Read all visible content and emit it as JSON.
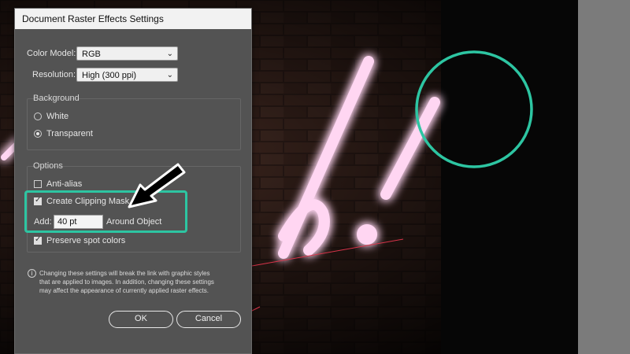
{
  "dialog": {
    "title": "Document Raster Effects Settings",
    "color_model_label": "Color Model:",
    "color_model_value": "RGB",
    "resolution_label": "Resolution:",
    "resolution_value": "High (300 ppi)",
    "background_group": "Background",
    "white_label": "White",
    "transparent_label": "Transparent",
    "options_group": "Options",
    "anti_alias_label": "Anti-alias",
    "clipping_mask_label": "Create Clipping Mask",
    "add_label": "Add:",
    "add_value": "40 pt",
    "around_object_label": "Around Object",
    "preserve_spot_label": "Preserve spot colors",
    "note_line1": "Changing these settings will break the link with graphic styles",
    "note_line2": "that are applied to images. In addition, changing these settings",
    "note_line3": "may affect the appearance of currently applied raster effects.",
    "ok_label": "OK",
    "cancel_label": "Cancel"
  },
  "state": {
    "background_selected": "Transparent",
    "anti_alias": false,
    "create_clipping_mask": true,
    "preserve_spot_colors": true
  },
  "icons": {
    "chevron": "chevron-down-icon",
    "info": "info-icon",
    "arrow": "pointer-arrow-icon"
  },
  "colors": {
    "dialog_bg": "#535353",
    "highlight": "#2dc5a2",
    "neon": "#ff9ee0"
  }
}
